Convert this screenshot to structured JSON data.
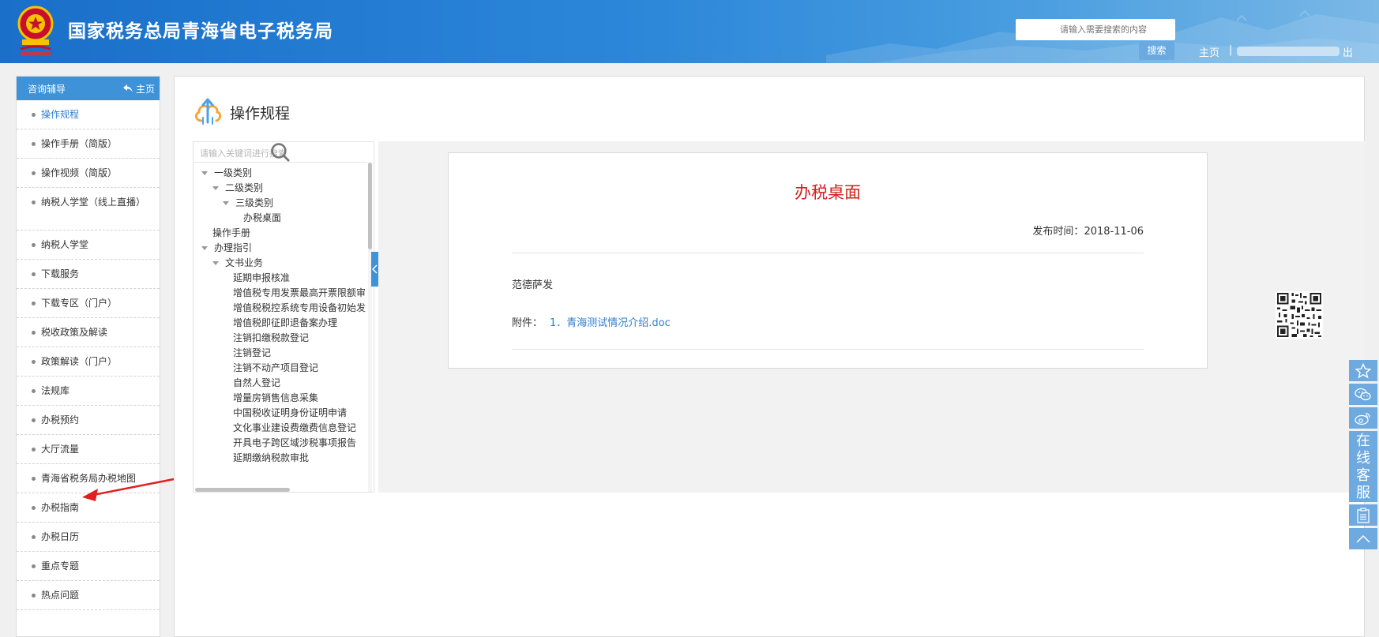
{
  "header": {
    "site_title": "国家税务总局青海省电子税务局",
    "search_placeholder": "请输入需要搜索的内容",
    "search_button": "搜索",
    "home_link": "主页",
    "separator": "|",
    "logout_fragment": "出"
  },
  "sidebar": {
    "title": "咨询辅导",
    "home_label": "主页",
    "items": [
      {
        "label": "操作规程",
        "active": true
      },
      {
        "label": "操作手册（简版）"
      },
      {
        "label": "操作视频（简版）"
      },
      {
        "label": "纳税人学堂（线上直播）"
      },
      {
        "label": "纳税人学堂"
      },
      {
        "label": "下载服务"
      },
      {
        "label": "下载专区（门户）"
      },
      {
        "label": "税收政策及解读"
      },
      {
        "label": "政策解读（门户）"
      },
      {
        "label": "法规库"
      },
      {
        "label": "办税预约"
      },
      {
        "label": "大厅流量"
      },
      {
        "label": "青海省税务局办税地图"
      },
      {
        "label": "办税指南"
      },
      {
        "label": "办税日历"
      },
      {
        "label": "重点专题"
      },
      {
        "label": "热点问题"
      }
    ]
  },
  "main": {
    "page_title": "操作规程",
    "tree_search_placeholder": "请输入关键词进行搜索",
    "tree": [
      {
        "label": "一级类别",
        "expanded": true
      },
      {
        "label": "二级类别",
        "expanded": true
      },
      {
        "label": "三级类别",
        "expanded": true
      },
      {
        "label": "办税桌面"
      },
      {
        "label": "操作手册"
      },
      {
        "label": "办理指引",
        "expanded": true
      },
      {
        "label": "文书业务",
        "expanded": true
      },
      {
        "label": "延期申报核准"
      },
      {
        "label": "增值税专用发票最高开票限额审"
      },
      {
        "label": "增值税税控系统专用设备初始发"
      },
      {
        "label": "增值税即征即退备案办理"
      },
      {
        "label": "注销扣缴税款登记"
      },
      {
        "label": "注销登记"
      },
      {
        "label": "注销不动产项目登记"
      },
      {
        "label": "自然人登记"
      },
      {
        "label": "增量房销售信息采集"
      },
      {
        "label": "中国税收证明身份证明申请"
      },
      {
        "label": "文化事业建设费缴费信息登记"
      },
      {
        "label": "开具电子跨区域涉税事项报告"
      },
      {
        "label": "延期缴纳税款审批"
      }
    ],
    "document": {
      "title": "办税桌面",
      "publish_label": "发布时间：",
      "publish_date": "2018-11-06",
      "body": "范德萨发",
      "attachment_label": "附件：",
      "attachment_link": "1．青海测试情况介绍.doc"
    }
  },
  "floatbar": {
    "service_chars": [
      "在",
      "线",
      "客",
      "服"
    ]
  },
  "colors": {
    "header_blue": "#1a6fc9",
    "sidebar_head": "#3e92d8",
    "active_link": "#2e7fd0",
    "doc_title_red": "#d42020",
    "float_blue": "#6eaae0"
  }
}
